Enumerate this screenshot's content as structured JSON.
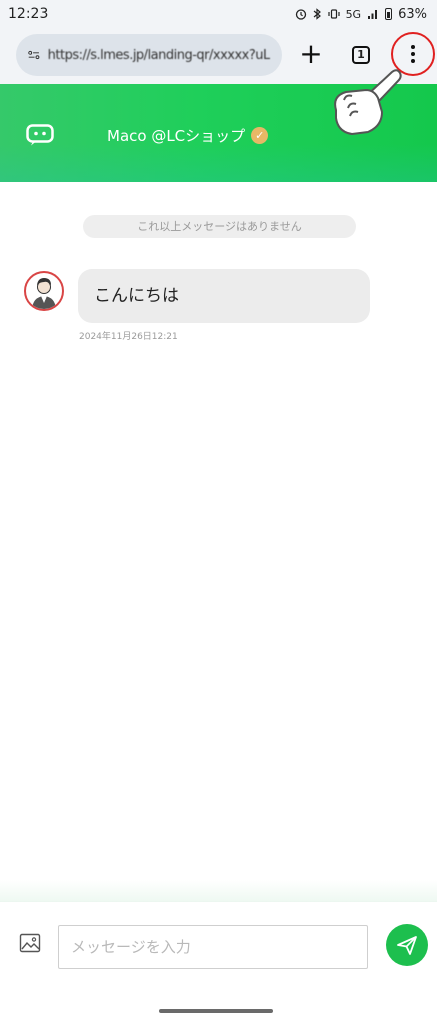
{
  "status_bar": {
    "time": "12:23",
    "network": "5G",
    "battery": "63%"
  },
  "browser": {
    "url": "https://s.lmes.jp/landing-qr/xxxxx?uLand=xxxxxxx",
    "tab_count": "1"
  },
  "chat": {
    "account_name": "Maco @LCショップ",
    "no_more_messages": "これ以上メッセージはありません",
    "messages": [
      {
        "text": "こんにちは",
        "timestamp": "2024年11月26日12:21"
      }
    ]
  },
  "composer": {
    "placeholder": "メッセージを入力"
  },
  "colors": {
    "header_green": "#1fcf5a",
    "send_button": "#1dbf4e",
    "highlight_ring": "#e02020"
  }
}
